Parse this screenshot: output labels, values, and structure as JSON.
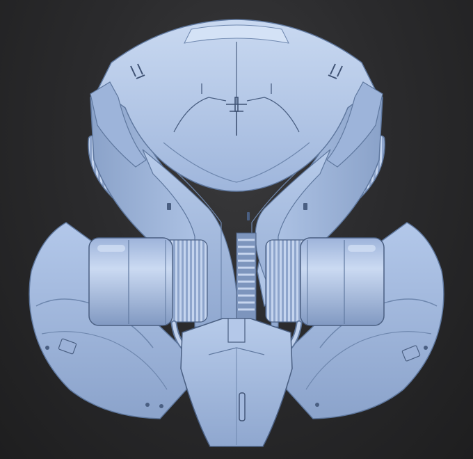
{
  "viewport": {
    "background": "#2b2b2d",
    "background_edge": "#1e1e1f"
  },
  "model": {
    "subject": "sci-fi-armored-helmet",
    "material_color": "#a9c0e4",
    "highlight_color": "#d2e0f4",
    "shadow_color": "#5f789f",
    "line_color": "#4a5f82"
  }
}
